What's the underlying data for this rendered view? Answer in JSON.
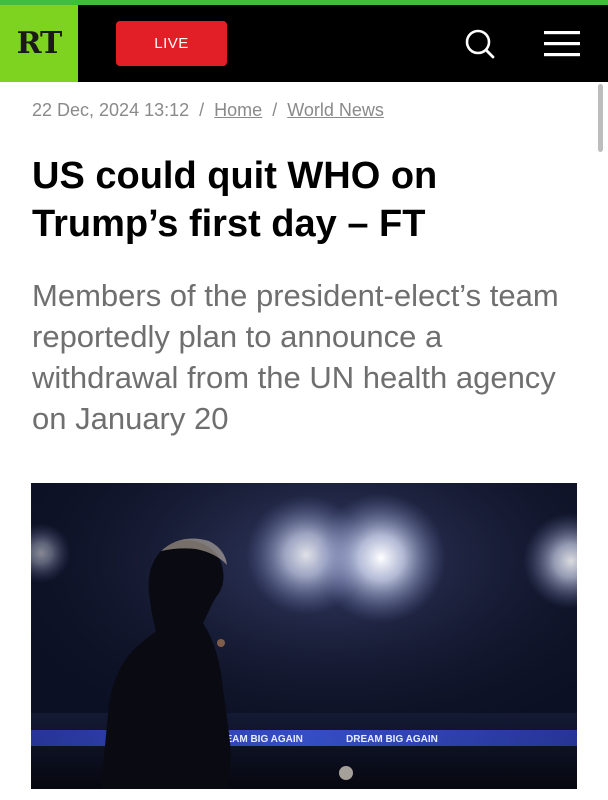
{
  "header": {
    "logo_text": "RT",
    "live_label": "LIVE",
    "search_icon": "search-icon",
    "menu_icon": "hamburger-menu-icon",
    "colors": {
      "brand_green": "#7ed321",
      "live_red": "#e21f26",
      "bar_black": "#000000"
    }
  },
  "breadcrumb": {
    "date": "22 Dec, 2024 13:12",
    "separator": "/",
    "items": [
      "Home",
      "World News"
    ]
  },
  "article": {
    "headline": "US could quit WHO on Trump’s first day – FT",
    "subtitle": "Members of the president-elect’s team reportedly plan to announce a withdrawal from the UN health agency on January 20"
  },
  "image": {
    "banner_text": "DREAM BIG AGAIN"
  }
}
